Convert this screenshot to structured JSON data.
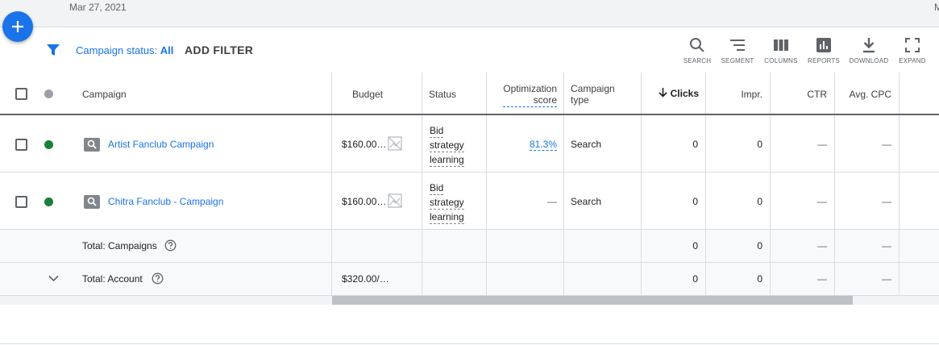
{
  "top": {
    "date": "Mar 27, 2021",
    "edge_text": "M"
  },
  "filter": {
    "label": "Campaign status:",
    "value": "All",
    "add_filter": "ADD FILTER"
  },
  "tools": [
    {
      "icon": "search-icon",
      "label": "SEARCH"
    },
    {
      "icon": "segment-icon",
      "label": "SEGMENT"
    },
    {
      "icon": "columns-icon",
      "label": "COLUMNS"
    },
    {
      "icon": "reports-icon",
      "label": "REPORTS"
    },
    {
      "icon": "download-icon",
      "label": "DOWNLOAD"
    },
    {
      "icon": "expand-icon",
      "label": "EXPAND"
    }
  ],
  "table": {
    "headers": {
      "campaign": "Campaign",
      "budget": "Budget",
      "status": "Status",
      "opt_score_1": "Optimization",
      "opt_score_2": "score",
      "type_1": "Campaign",
      "type_2": "type",
      "clicks": "Clicks",
      "impr": "Impr.",
      "ctr": "CTR",
      "avg_cpc": "Avg. CPC"
    },
    "rows": [
      {
        "name": "Artist Fanclub Campaign",
        "budget": "$160.00…",
        "status_1": "Bid",
        "status_2": "strategy",
        "status_3": "learning",
        "opt_score": "81.3%",
        "type": "Search",
        "clicks": "0",
        "impr": "0",
        "ctr": "—",
        "avg_cpc": "—"
      },
      {
        "name": "Chitra Fanclub - Campaign",
        "budget": "$160.00…",
        "status_1": "Bid",
        "status_2": "strategy",
        "status_3": "learning",
        "opt_score": "—",
        "type": "Search",
        "clicks": "0",
        "impr": "0",
        "ctr": "—",
        "avg_cpc": "—"
      }
    ],
    "total_campaigns": {
      "label": "Total: Campaigns",
      "clicks": "0",
      "impr": "0",
      "ctr": "—",
      "avg_cpc": "—"
    },
    "total_account": {
      "label": "Total: Account",
      "budget": "$320.00/…",
      "clicks": "0",
      "impr": "0",
      "ctr": "—",
      "avg_cpc": "—"
    }
  },
  "colors": {
    "accent": "#1a73e8",
    "enabled": "#188038",
    "muted": "#9aa0a6"
  }
}
